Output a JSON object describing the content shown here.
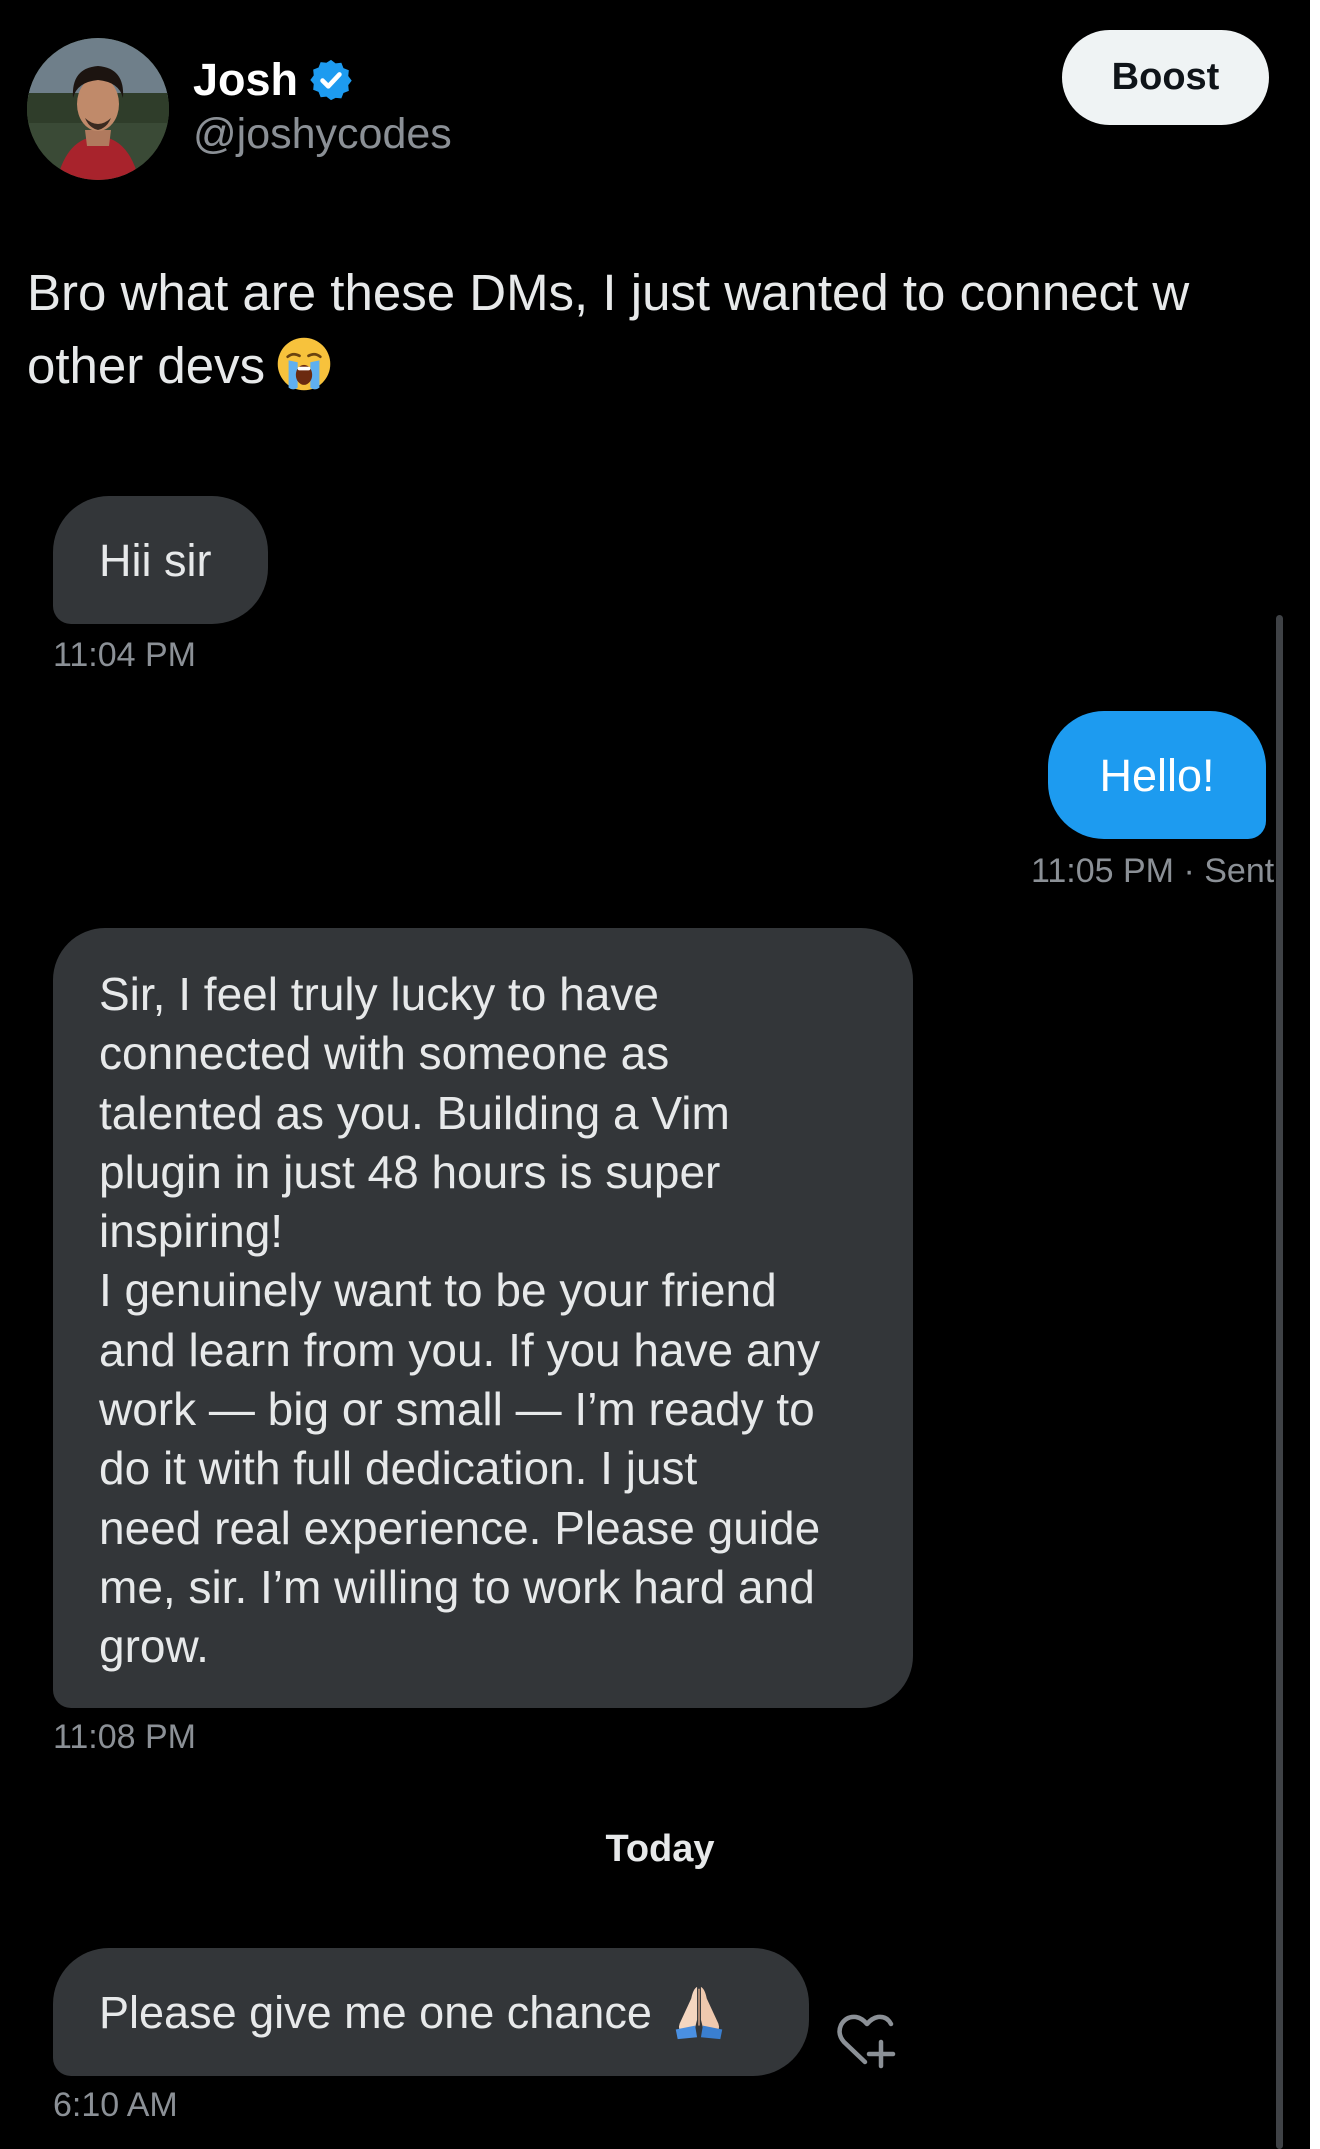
{
  "header": {
    "author_name": "Josh",
    "handle": "@joshycodes",
    "boost_label": "Boost"
  },
  "tweet": {
    "text": "Bro what are these DMs, I just wanted to connect w other devs"
  },
  "messages": [
    {
      "direction": "incoming",
      "text": "Hii sir",
      "time": "11:04 PM"
    },
    {
      "direction": "outgoing",
      "text": "Hello!",
      "time": "11:05 PM",
      "status": "· Sent"
    },
    {
      "direction": "incoming",
      "text": "Sir, I feel truly lucky to have\nconnected with someone as\ntalented as you. Building a Vim\nplugin in just 48 hours is super\ninspiring!\nI genuinely want to be your friend\nand learn from you. If you have any\nwork — big or small — I’m ready to\ndo it with full dedication. I just\nneed real experience. Please guide\nme, sir. I’m willing to work hard and\ngrow.",
      "time": "11:08 PM"
    },
    {
      "direction": "incoming",
      "text": "Please give me one chance",
      "time": "6:10 AM"
    }
  ],
  "day_separator": "Today",
  "colors": {
    "background": "#000000",
    "incoming_bubble": "#333639",
    "outgoing_bubble": "#1d9bf0",
    "verified_badge": "#1d9bf0",
    "muted_text": "#8b9096"
  },
  "icons": {
    "verified": "verified-badge-icon",
    "tweet_emoji": "loudly-crying-face-emoji",
    "message_emoji": "folded-hands-emoji",
    "react": "heart-plus-icon"
  }
}
